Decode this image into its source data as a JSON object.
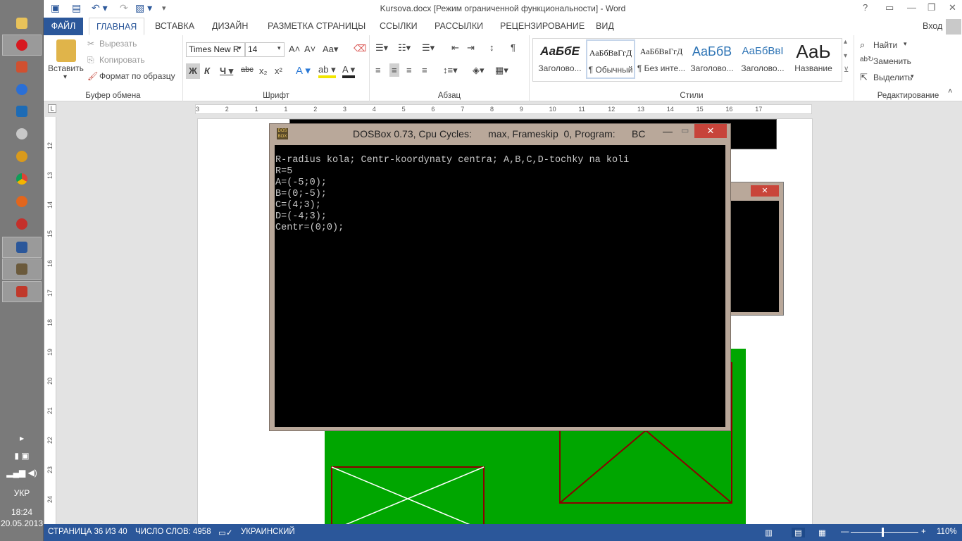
{
  "title": "Kursova.docx [Режим ограниченной функциональности] - Word",
  "taskbar": {
    "lang": "УКР",
    "time": "18:24",
    "date": "20.05.2013"
  },
  "tabs": [
    {
      "label": "ФАЙЛ"
    },
    {
      "label": "ГЛАВНАЯ"
    },
    {
      "label": "ВСТАВКА"
    },
    {
      "label": "ДИЗАЙН"
    },
    {
      "label": "РАЗМЕТКА СТРАНИЦЫ"
    },
    {
      "label": "ССЫЛКИ"
    },
    {
      "label": "РАССЫЛКИ"
    },
    {
      "label": "РЕЦЕНЗИРОВАНИЕ"
    },
    {
      "label": "ВИД"
    }
  ],
  "signin": "Вход",
  "clipboard": {
    "paste": "Вставить",
    "cut": "Вырезать",
    "copy": "Копировать",
    "format_painter": "Формат по образцу",
    "label": "Буфер обмена"
  },
  "font": {
    "name": "Times New R",
    "size": "14",
    "label": "Шрифт"
  },
  "paragraph": {
    "label": "Абзац"
  },
  "styles": {
    "label": "Стили",
    "items": [
      {
        "sample": "АаБбЕ",
        "name": "Заголово..."
      },
      {
        "sample": "АаБбВвГгД",
        "name": "¶ Обычный"
      },
      {
        "sample": "АаБбВвГгД",
        "name": "¶ Без инте..."
      },
      {
        "sample": "АаБбВ",
        "name": "Заголово..."
      },
      {
        "sample": "АаБбВвІ",
        "name": "Заголово..."
      },
      {
        "sample": "АаЬ",
        "name": "Название"
      }
    ]
  },
  "editing": {
    "find": "Найти",
    "replace": "Заменить",
    "select": "Выделить",
    "label": "Редактирование"
  },
  "ruler_h": [
    "3",
    "2",
    "1",
    "1",
    "2",
    "3",
    "4",
    "5",
    "6",
    "7",
    "8",
    "9",
    "10",
    "11",
    "12",
    "13",
    "14",
    "15",
    "16",
    "17"
  ],
  "ruler_v": [
    "12",
    "13",
    "14",
    "15",
    "16",
    "17",
    "18",
    "19",
    "20",
    "21",
    "22",
    "23",
    "24"
  ],
  "dosbox": {
    "title": "DOSBox 0.73, Cpu Cycles:      max, Frameskip  0, Program:      BC",
    "lines": [
      "R-radius kola; Centr-koordynaty centra; A,B,C,D-tochky na koli",
      "R=5",
      "A=(-5;0);",
      "B=(0;-5);",
      "C=(4;3);",
      "D=(-4;3);",
      "Centr=(0;0);"
    ]
  },
  "status": {
    "page": "СТРАНИЦА 36 ИЗ 40",
    "words": "ЧИСЛО СЛОВ: 4958",
    "lang": "УКРАИНСКИЙ",
    "zoom": "110%"
  },
  "colors": {
    "accent": "#2b579a",
    "green": "#00a600",
    "darkred": "#8b0000"
  }
}
